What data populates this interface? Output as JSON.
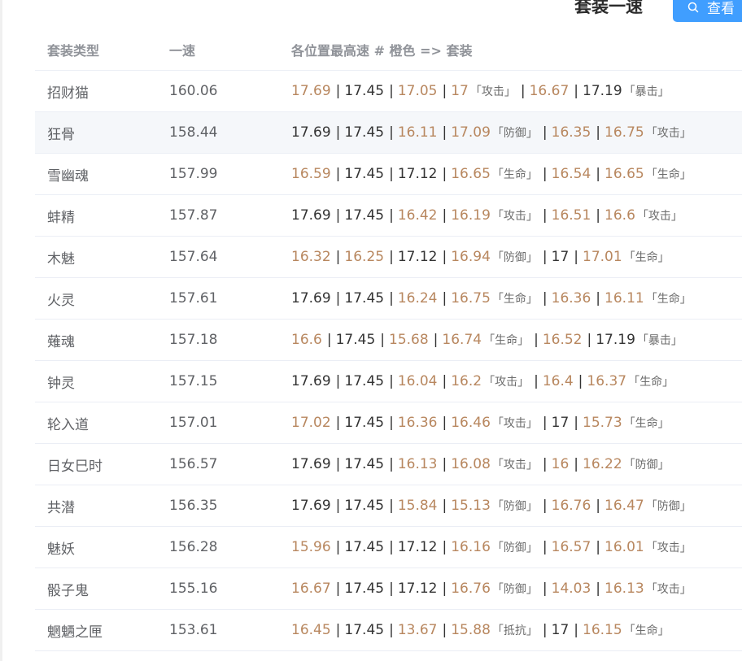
{
  "header": {
    "section_title": "套装一速",
    "view_button_label": "查看"
  },
  "table": {
    "columns": {
      "name": "套装类型",
      "speed": "一速",
      "detail": "各位置最高速 # 橙色 => 套装"
    },
    "rows": [
      {
        "name": "招财猫",
        "speed": "160.06",
        "hover": false,
        "segments": [
          {
            "v": "17.69",
            "set": true
          },
          {
            "v": "17.45",
            "set": false
          },
          {
            "v": "17.05",
            "set": true
          },
          {
            "v": "17",
            "set": true,
            "tag": "「攻击」"
          },
          {
            "v": "16.67",
            "set": true
          },
          {
            "v": "17.19",
            "set": false,
            "tag": "「暴击」"
          }
        ]
      },
      {
        "name": "狂骨",
        "speed": "158.44",
        "hover": true,
        "segments": [
          {
            "v": "17.69",
            "set": false
          },
          {
            "v": "17.45",
            "set": false
          },
          {
            "v": "16.11",
            "set": true
          },
          {
            "v": "17.09",
            "set": true,
            "tag": "「防御」"
          },
          {
            "v": "16.35",
            "set": true
          },
          {
            "v": "16.75",
            "set": true,
            "tag": "「攻击」"
          }
        ]
      },
      {
        "name": "雪幽魂",
        "speed": "157.99",
        "hover": false,
        "segments": [
          {
            "v": "16.59",
            "set": true
          },
          {
            "v": "17.45",
            "set": false
          },
          {
            "v": "17.12",
            "set": false
          },
          {
            "v": "16.65",
            "set": true,
            "tag": "「生命」"
          },
          {
            "v": "16.54",
            "set": true
          },
          {
            "v": "16.65",
            "set": true,
            "tag": "「生命」"
          }
        ]
      },
      {
        "name": "蚌精",
        "speed": "157.87",
        "hover": false,
        "segments": [
          {
            "v": "17.69",
            "set": false
          },
          {
            "v": "17.45",
            "set": false
          },
          {
            "v": "16.42",
            "set": true
          },
          {
            "v": "16.19",
            "set": true,
            "tag": "「攻击」"
          },
          {
            "v": "16.51",
            "set": true
          },
          {
            "v": "16.6",
            "set": true,
            "tag": "「攻击」"
          }
        ]
      },
      {
        "name": "木魅",
        "speed": "157.64",
        "hover": false,
        "segments": [
          {
            "v": "16.32",
            "set": true
          },
          {
            "v": "16.25",
            "set": true
          },
          {
            "v": "17.12",
            "set": false
          },
          {
            "v": "16.94",
            "set": true,
            "tag": "「防御」"
          },
          {
            "v": "17",
            "set": false
          },
          {
            "v": "17.01",
            "set": true,
            "tag": "「生命」"
          }
        ]
      },
      {
        "name": "火灵",
        "speed": "157.61",
        "hover": false,
        "segments": [
          {
            "v": "17.69",
            "set": false
          },
          {
            "v": "17.45",
            "set": false
          },
          {
            "v": "16.24",
            "set": true
          },
          {
            "v": "16.75",
            "set": true,
            "tag": "「生命」"
          },
          {
            "v": "16.36",
            "set": true
          },
          {
            "v": "16.11",
            "set": true,
            "tag": "「生命」"
          }
        ]
      },
      {
        "name": "薙魂",
        "speed": "157.18",
        "hover": false,
        "segments": [
          {
            "v": "16.6",
            "set": true
          },
          {
            "v": "17.45",
            "set": false
          },
          {
            "v": "15.68",
            "set": true
          },
          {
            "v": "16.74",
            "set": true,
            "tag": "「生命」"
          },
          {
            "v": "16.52",
            "set": true
          },
          {
            "v": "17.19",
            "set": false,
            "tag": "「暴击」"
          }
        ]
      },
      {
        "name": "钟灵",
        "speed": "157.15",
        "hover": false,
        "segments": [
          {
            "v": "17.69",
            "set": false
          },
          {
            "v": "17.45",
            "set": false
          },
          {
            "v": "16.04",
            "set": true
          },
          {
            "v": "16.2",
            "set": true,
            "tag": "「攻击」"
          },
          {
            "v": "16.4",
            "set": true
          },
          {
            "v": "16.37",
            "set": true,
            "tag": "「生命」"
          }
        ]
      },
      {
        "name": "轮入道",
        "speed": "157.01",
        "hover": false,
        "segments": [
          {
            "v": "17.02",
            "set": true
          },
          {
            "v": "17.45",
            "set": false
          },
          {
            "v": "16.36",
            "set": true
          },
          {
            "v": "16.46",
            "set": true,
            "tag": "「攻击」"
          },
          {
            "v": "17",
            "set": false
          },
          {
            "v": "15.73",
            "set": true,
            "tag": "「生命」"
          }
        ]
      },
      {
        "name": "日女巳时",
        "speed": "156.57",
        "hover": false,
        "segments": [
          {
            "v": "17.69",
            "set": false
          },
          {
            "v": "17.45",
            "set": false
          },
          {
            "v": "16.13",
            "set": true
          },
          {
            "v": "16.08",
            "set": true,
            "tag": "「攻击」"
          },
          {
            "v": "16",
            "set": true
          },
          {
            "v": "16.22",
            "set": true,
            "tag": "「防御」"
          }
        ]
      },
      {
        "name": "共潜",
        "speed": "156.35",
        "hover": false,
        "segments": [
          {
            "v": "17.69",
            "set": false
          },
          {
            "v": "17.45",
            "set": false
          },
          {
            "v": "15.84",
            "set": true
          },
          {
            "v": "15.13",
            "set": true,
            "tag": "「防御」"
          },
          {
            "v": "16.76",
            "set": true
          },
          {
            "v": "16.47",
            "set": true,
            "tag": "「防御」"
          }
        ]
      },
      {
        "name": "魅妖",
        "speed": "156.28",
        "hover": false,
        "segments": [
          {
            "v": "15.96",
            "set": true
          },
          {
            "v": "17.45",
            "set": false
          },
          {
            "v": "17.12",
            "set": false
          },
          {
            "v": "16.16",
            "set": true,
            "tag": "「防御」"
          },
          {
            "v": "16.57",
            "set": true
          },
          {
            "v": "16.01",
            "set": true,
            "tag": "「攻击」"
          }
        ]
      },
      {
        "name": "骰子鬼",
        "speed": "155.16",
        "hover": false,
        "segments": [
          {
            "v": "16.67",
            "set": true
          },
          {
            "v": "17.45",
            "set": false
          },
          {
            "v": "17.12",
            "set": false
          },
          {
            "v": "16.76",
            "set": true,
            "tag": "「防御」"
          },
          {
            "v": "14.03",
            "set": true
          },
          {
            "v": "16.13",
            "set": true,
            "tag": "「攻击」"
          }
        ]
      },
      {
        "name": "魍魉之匣",
        "speed": "153.61",
        "hover": false,
        "segments": [
          {
            "v": "16.45",
            "set": true
          },
          {
            "v": "17.45",
            "set": false
          },
          {
            "v": "13.67",
            "set": true
          },
          {
            "v": "15.88",
            "set": true,
            "tag": "「抵抗」"
          },
          {
            "v": "17",
            "set": false
          },
          {
            "v": "16.15",
            "set": true,
            "tag": "「生命」"
          }
        ]
      }
    ]
  },
  "colors": {
    "set_value": "#b8875f",
    "normal_value": "#333333",
    "button": "#409eff",
    "hover_row": "#f5f7fa"
  },
  "icons": {
    "view_button": "search-icon"
  }
}
